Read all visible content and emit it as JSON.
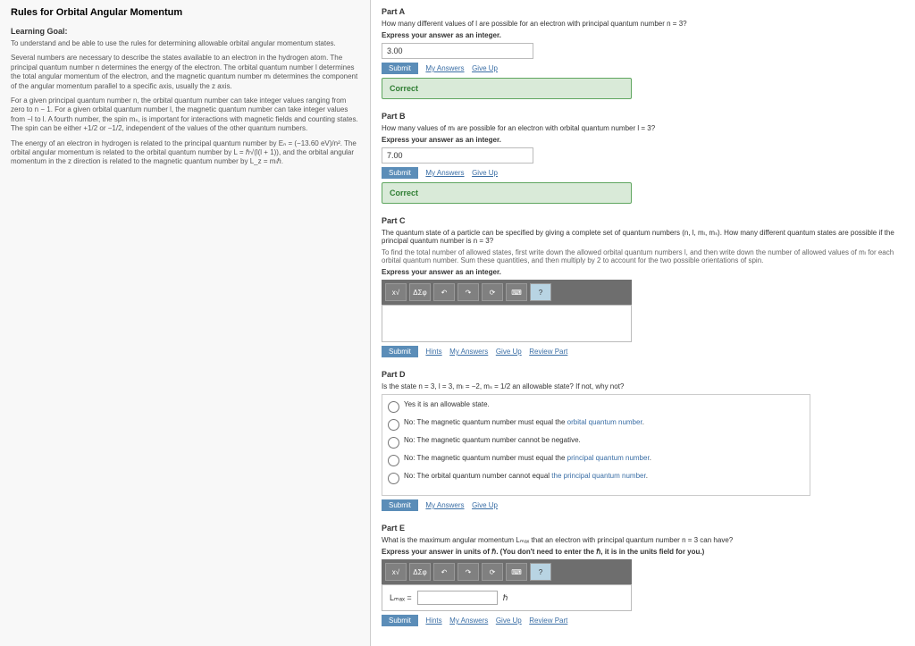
{
  "header": {
    "title": "Rules for Orbital Angular Momentum"
  },
  "left": {
    "goal_label": "Learning Goal:",
    "goal_text": "To understand and be able to use the rules for determining allowable orbital angular momentum states.",
    "p1": "Several numbers are necessary to describe the states available to an electron in the hydrogen atom. The principal quantum number n determines the energy of the electron. The orbital quantum number l determines the total angular momentum of the electron, and the magnetic quantum number mₗ determines the component of the angular momentum parallel to a specific axis, usually the z axis.",
    "p2": "For a given principal quantum number n, the orbital quantum number can take integer values ranging from zero to n − 1. For a given orbital quantum number l, the magnetic quantum number can take integer values from −l to l. A fourth number, the spin mₛ, is important for interactions with magnetic fields and counting states. The spin can be either +1/2 or −1/2, independent of the values of the other quantum numbers.",
    "p3": "The energy of an electron in hydrogen is related to the principal quantum number by Eₙ = (−13.60 eV)/n². The orbital angular momentum is related to the orbital quantum number by L = ℏ√(l(l + 1)), and the orbital angular momentum in the z direction is related to the magnetic quantum number by L_z = mₗℏ."
  },
  "partA": {
    "title": "Part A",
    "prompt": "How many different values of l are possible for an electron with principal quantum number n = 3?",
    "express": "Express your answer as an integer.",
    "value": "3.00",
    "submit": "Submit",
    "my_answers": "My Answers",
    "give_up": "Give Up",
    "feedback": "Correct"
  },
  "partB": {
    "title": "Part B",
    "prompt": "How many values of mₗ are possible for an electron with orbital quantum number l = 3?",
    "express": "Express your answer as an integer.",
    "value": "7.00",
    "submit": "Submit",
    "my_answers": "My Answers",
    "give_up": "Give Up",
    "feedback": "Correct"
  },
  "partC": {
    "title": "Part C",
    "prompt": "The quantum state of a particle can be specified by giving a complete set of quantum numbers (n, l, mₗ, mₛ). How many different quantum states are possible if the principal quantum number is n = 3?",
    "hint": "To find the total number of allowed states, first write down the allowed orbital quantum numbers l, and then write down the number of allowed values of mₗ for each orbital quantum number. Sum these quantities, and then multiply by 2 to account for the two possible orientations of spin.",
    "express": "Express your answer as an integer.",
    "submit": "Submit",
    "hints": "Hints",
    "my_answers": "My Answers",
    "give_up": "Give Up",
    "review": "Review Part"
  },
  "partD": {
    "title": "Part D",
    "prompt": "Is the state n = 3, l = 3, mₗ = −2, mₛ = 1/2 an allowable state? If not, why not?",
    "opts": [
      "Yes it is an allowable state.",
      "No: The magnetic quantum number must equal the orbital quantum number.",
      "No: The magnetic quantum number cannot be negative.",
      "No: The magnetic quantum number must equal the principal quantum number.",
      "No: The orbital quantum number cannot equal the principal quantum number."
    ],
    "submit": "Submit",
    "my_answers": "My Answers",
    "give_up": "Give Up"
  },
  "partE": {
    "title": "Part E",
    "prompt": "What is the maximum angular momentum Lₘₐₓ that an electron with principal quantum number n = 3 can have?",
    "express": "Express your answer in units of ℏ. (You don't need to enter the ℏ, it is in the units field for you.)",
    "var": "Lₘₐₓ =",
    "unit": "ℏ",
    "submit": "Submit",
    "hints": "Hints",
    "my_answers": "My Answers",
    "give_up": "Give Up",
    "review": "Review Part"
  },
  "toolbar_icons": [
    "x√",
    "ΔΣφ",
    "↶",
    "↷",
    "⟳",
    "⌨",
    "?"
  ]
}
